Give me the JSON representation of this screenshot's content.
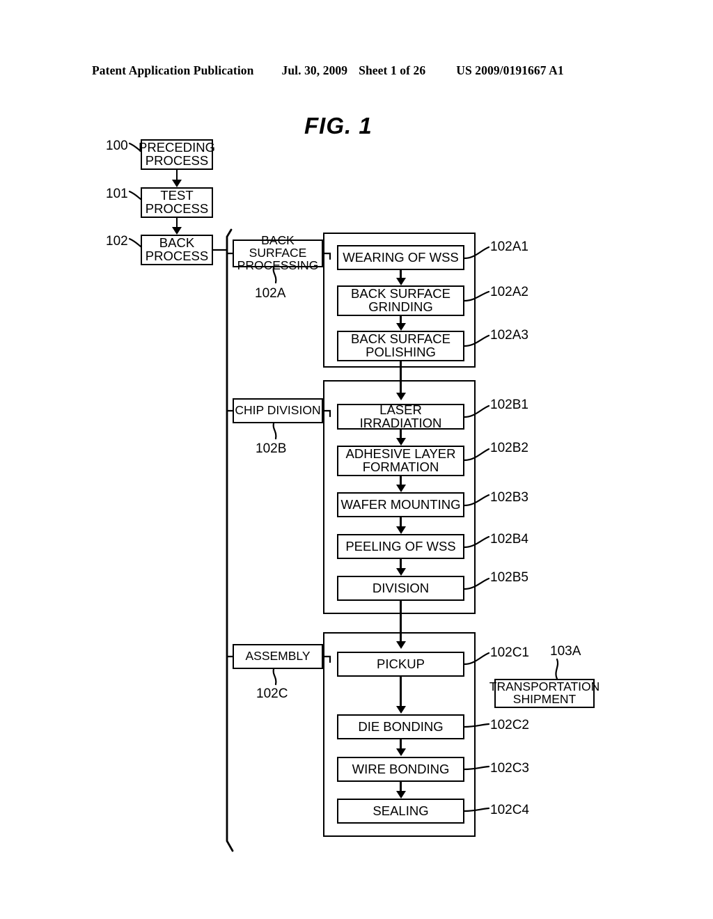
{
  "header": {
    "publication": "Patent Application Publication",
    "date": "Jul. 30, 2009",
    "sheet": "Sheet 1 of 26",
    "patent_number": "US 2009/0191667 A1"
  },
  "figure": {
    "title": "FIG.  1"
  },
  "main_flow": [
    {
      "ref": "100",
      "label_line1": "PRECEDING",
      "label_line2": "PROCESS"
    },
    {
      "ref": "101",
      "label_line1": "TEST",
      "label_line2": "PROCESS"
    },
    {
      "ref": "102",
      "label_line1": "BACK",
      "label_line2": "PROCESS"
    }
  ],
  "groups": [
    {
      "ref": "102A",
      "name_line1": "BACK SURFACE",
      "name_line2": "PROCESSING",
      "steps": [
        {
          "ref": "102A1",
          "line1": "WEARING OF WSS",
          "line2": ""
        },
        {
          "ref": "102A2",
          "line1": "BACK SURFACE",
          "line2": "GRINDING"
        },
        {
          "ref": "102A3",
          "line1": "BACK SURFACE",
          "line2": "POLISHING"
        }
      ]
    },
    {
      "ref": "102B",
      "name_line1": "CHIP DIVISION",
      "name_line2": "",
      "steps": [
        {
          "ref": "102B1",
          "line1": "LASER IRRADIATION",
          "line2": ""
        },
        {
          "ref": "102B2",
          "line1": "ADHESIVE LAYER",
          "line2": "FORMATION"
        },
        {
          "ref": "102B3",
          "line1": "WAFER MOUNTING",
          "line2": ""
        },
        {
          "ref": "102B4",
          "line1": "PEELING OF WSS",
          "line2": ""
        },
        {
          "ref": "102B5",
          "line1": "DIVISION",
          "line2": ""
        }
      ]
    },
    {
      "ref": "102C",
      "name_line1": "ASSEMBLY",
      "name_line2": "",
      "steps": [
        {
          "ref": "102C1",
          "line1": "PICKUP",
          "line2": ""
        },
        {
          "ref": "102C2",
          "line1": "DIE BONDING",
          "line2": ""
        },
        {
          "ref": "102C3",
          "line1": "WIRE BONDING",
          "line2": ""
        },
        {
          "ref": "102C4",
          "line1": "SEALING",
          "line2": ""
        }
      ]
    }
  ],
  "side_box": {
    "ref": "103A",
    "line1": "TRANSPORTATION",
    "line2": "SHIPMENT"
  },
  "colors": {
    "ink": "#000000",
    "paper": "#ffffff"
  }
}
